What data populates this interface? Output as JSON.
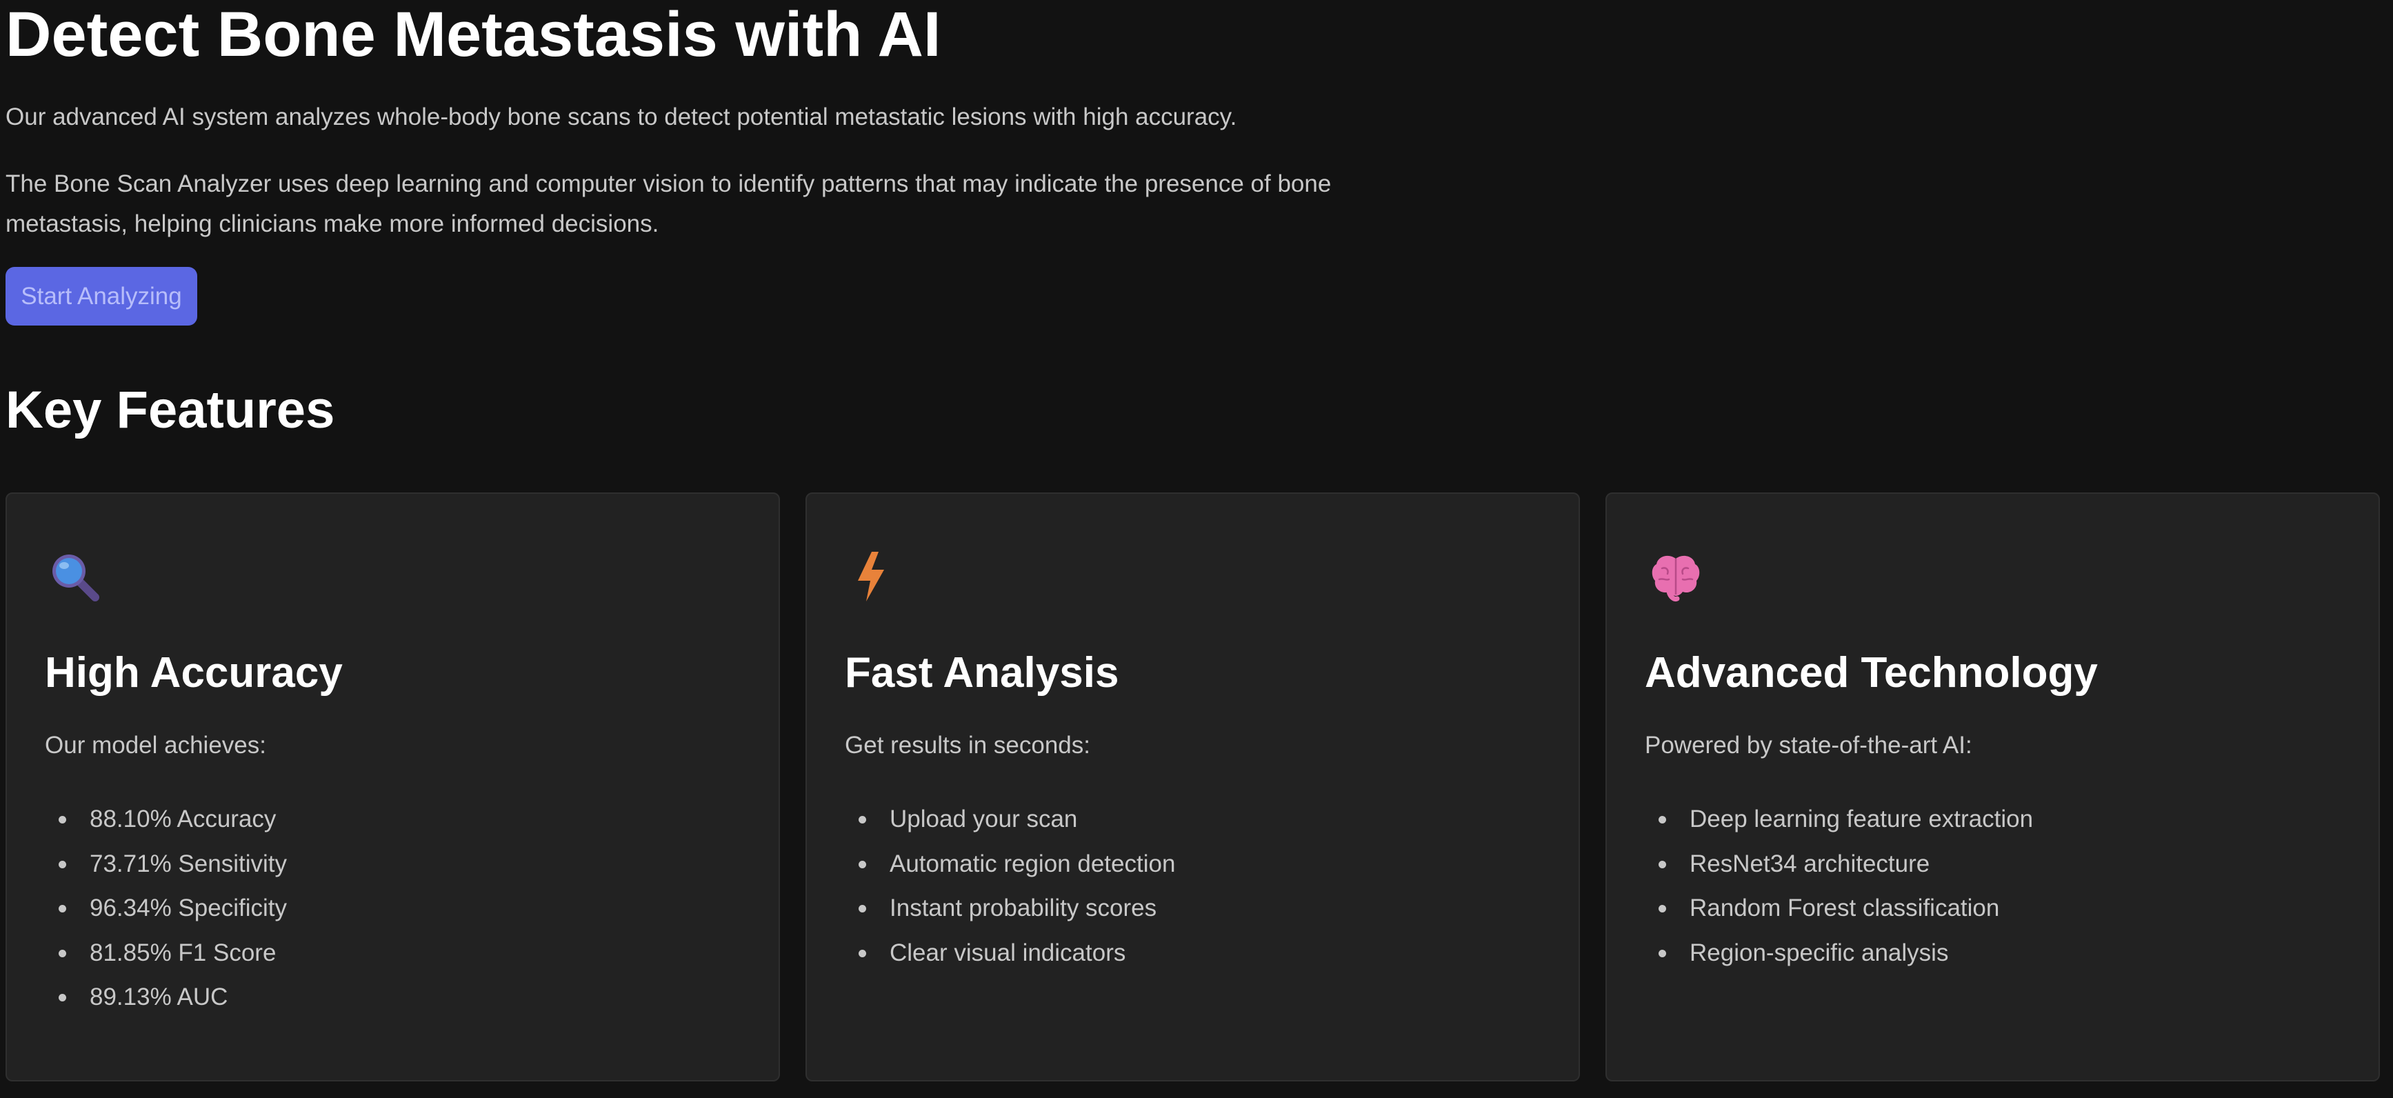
{
  "hero": {
    "title": "Detect Bone Metastasis with AI",
    "subtitle": "Our advanced AI system analyzes whole-body bone scans to detect potential metastatic lesions with high accuracy.",
    "description": "The Bone Scan Analyzer uses deep learning and computer vision to identify patterns that may indicate the presence of bone metastasis, helping clinicians make more informed decisions.",
    "cta_label": "Start Analyzing"
  },
  "features": {
    "title": "Key Features",
    "cards": [
      {
        "icon": "magnifying-glass-icon",
        "title": "High Accuracy",
        "intro": "Our model achieves:",
        "items": [
          "88.10% Accuracy",
          "73.71% Sensitivity",
          "96.34% Specificity",
          "81.85% F1 Score",
          "89.13% AUC"
        ]
      },
      {
        "icon": "lightning-icon",
        "title": "Fast Analysis",
        "intro": "Get results in seconds:",
        "items": [
          "Upload your scan",
          "Automatic region detection",
          "Instant probability scores",
          "Clear visual indicators"
        ]
      },
      {
        "icon": "brain-icon",
        "title": "Advanced Technology",
        "intro": "Powered by state-of-the-art AI:",
        "items": [
          "Deep learning feature extraction",
          "ResNet34 architecture",
          "Random Forest classification",
          "Region-specific analysis"
        ]
      }
    ]
  },
  "colors": {
    "background": "#121212",
    "card_background": "#222222",
    "accent_button": "#5b67e3",
    "text_primary": "#ffffff",
    "text_secondary": "#c8c8c8"
  }
}
